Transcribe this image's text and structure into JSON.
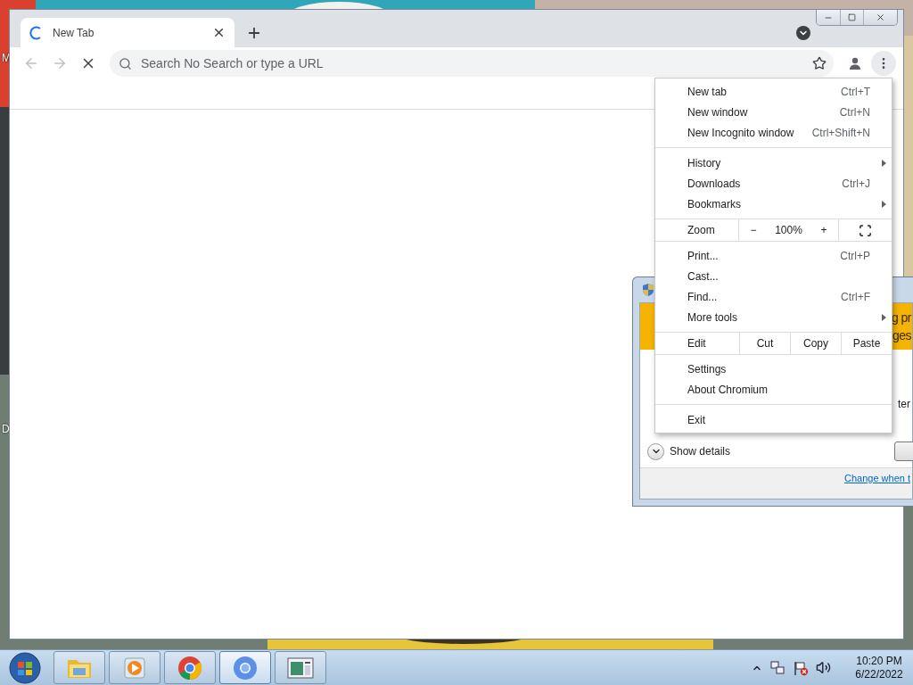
{
  "desktop": {
    "icon_labels": [
      "M",
      "D"
    ]
  },
  "browser": {
    "tab": {
      "title": "New Tab",
      "loading": true
    },
    "back_disabled": true,
    "forward_disabled": true,
    "omnibox": {
      "placeholder": "Search No Search or type a URL"
    }
  },
  "dialog": {
    "banner_lines": [
      "g pr",
      "ges"
    ],
    "body_text": "ter",
    "details_button": "Show details",
    "link": "Change when t"
  },
  "menu": {
    "sections": [
      {
        "kind": "items",
        "items": [
          {
            "label": "New tab",
            "shortcut": "Ctrl+T",
            "submenu": false
          },
          {
            "label": "New window",
            "shortcut": "Ctrl+N",
            "submenu": false
          },
          {
            "label": "New Incognito window",
            "shortcut": "Ctrl+Shift+N",
            "submenu": false
          }
        ]
      },
      {
        "kind": "items",
        "items": [
          {
            "label": "History",
            "submenu": true
          },
          {
            "label": "Downloads",
            "shortcut": "Ctrl+J",
            "submenu": false
          },
          {
            "label": "Bookmarks",
            "submenu": true
          }
        ]
      },
      {
        "kind": "zoom",
        "label": "Zoom",
        "minus": "−",
        "value": "100%",
        "plus": "+"
      },
      {
        "kind": "items",
        "items": [
          {
            "label": "Print...",
            "shortcut": "Ctrl+P",
            "submenu": false
          },
          {
            "label": "Cast...",
            "submenu": false
          },
          {
            "label": "Find...",
            "shortcut": "Ctrl+F",
            "submenu": false
          },
          {
            "label": "More tools",
            "submenu": true
          }
        ]
      },
      {
        "kind": "edit",
        "label": "Edit",
        "actions": [
          "Cut",
          "Copy",
          "Paste"
        ]
      },
      {
        "kind": "items",
        "items": [
          {
            "label": "Settings",
            "submenu": false
          },
          {
            "label": "About Chromium",
            "submenu": false
          }
        ]
      },
      {
        "kind": "items",
        "items": [
          {
            "label": "Exit",
            "submenu": false
          }
        ]
      }
    ]
  },
  "taskbar": {
    "apps": [
      {
        "kind": "folder",
        "selected": false
      },
      {
        "kind": "media",
        "selected": false
      },
      {
        "kind": "chrome",
        "selected": false
      },
      {
        "kind": "chromium",
        "selected": true
      },
      {
        "kind": "window",
        "selected": false
      }
    ],
    "clock": {
      "time": "10:20 PM",
      "date": "6/22/2022"
    }
  }
}
